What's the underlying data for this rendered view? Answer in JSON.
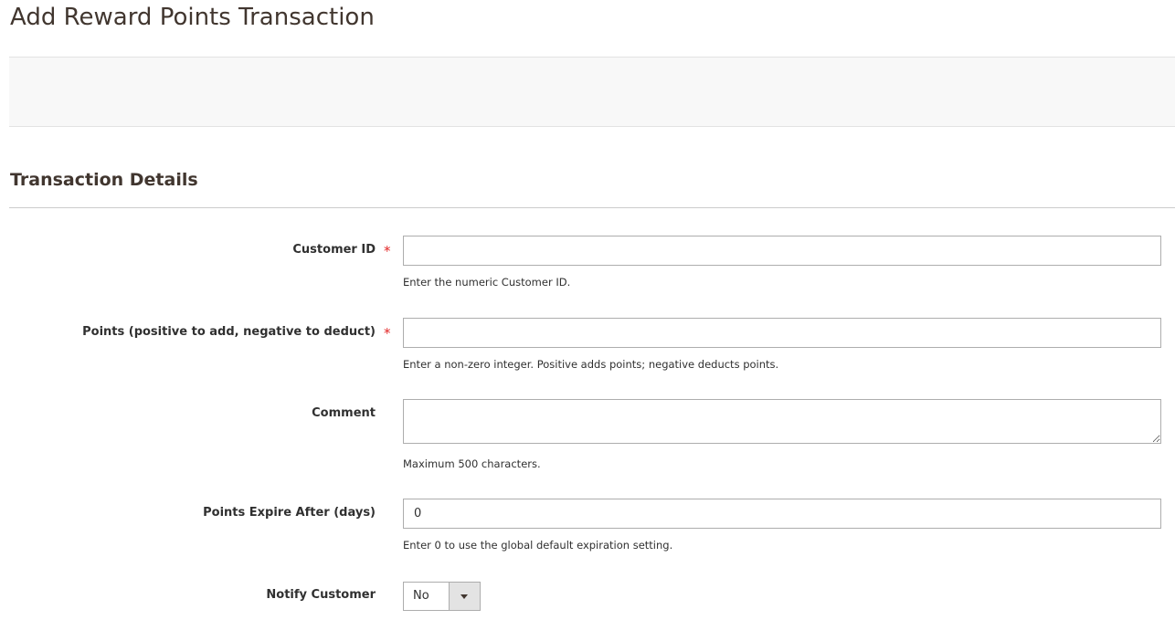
{
  "page": {
    "title": "Add Reward Points Transaction"
  },
  "section": {
    "title": "Transaction Details"
  },
  "fields": {
    "customer_id": {
      "label": "Customer ID",
      "required_mark": "*",
      "value": "",
      "hint": "Enter the numeric Customer ID."
    },
    "points": {
      "label": "Points (positive to add, negative to deduct)",
      "required_mark": "*",
      "value": "",
      "hint": "Enter a non-zero integer. Positive adds points; negative deducts points."
    },
    "comment": {
      "label": "Comment",
      "value": "",
      "hint": "Maximum 500 characters."
    },
    "expire_days": {
      "label": "Points Expire After (days)",
      "value": "0",
      "hint": "Enter 0 to use the global default expiration setting."
    },
    "notify_customer": {
      "label": "Notify Customer",
      "selected": "No",
      "icon": "chevron-down-icon"
    }
  },
  "colors": {
    "required": "#e22626",
    "title": "#41362f",
    "input_border": "#adadad",
    "actions_bar_bg": "#f8f8f8"
  }
}
